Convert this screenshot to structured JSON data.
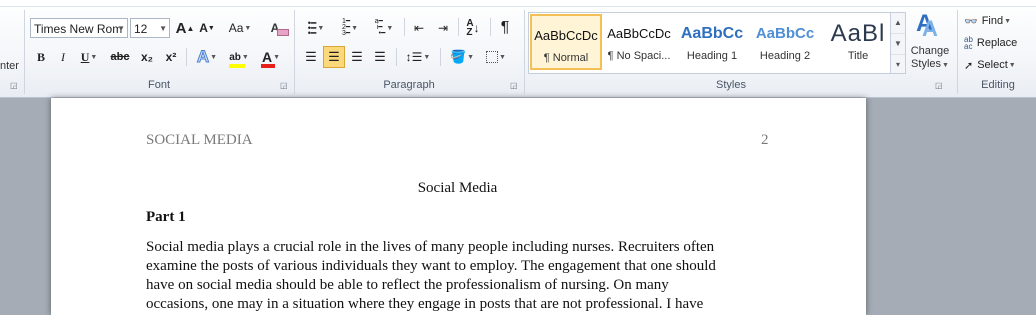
{
  "clipboard": {
    "partial_label": "nter"
  },
  "font": {
    "group_label": "Font",
    "name": "Times New Rom",
    "size": "12",
    "grow_glyph": "A",
    "shrink_glyph": "A",
    "case_glyph": "Aa",
    "clear_glyph": "A",
    "bold": "B",
    "italic": "I",
    "underline": "U",
    "strike": "abc",
    "subscript": "x₂",
    "superscript": "x²",
    "effects_glyph": "A",
    "highlight_glyph": "ab",
    "color_glyph": "A",
    "colors": {
      "highlight": "#ffff00",
      "font_color": "#e8201c",
      "effects": "#4a7fd4"
    }
  },
  "paragraph": {
    "group_label": "Paragraph",
    "pilcrow": "¶"
  },
  "styles": {
    "group_label": "Styles",
    "tiles": [
      {
        "sample": "AaBbCcDc",
        "name": "¶ Normal"
      },
      {
        "sample": "AaBbCcDc",
        "name": "¶ No Spaci..."
      },
      {
        "sample": "AaBbCc",
        "name": "Heading 1"
      },
      {
        "sample": "AaBbCc",
        "name": "Heading 2"
      },
      {
        "sample": "AaBl",
        "name": "Title"
      }
    ],
    "change_styles_line1": "Change",
    "change_styles_line2": "Styles",
    "heading_color": "#2e6fbf"
  },
  "editing": {
    "group_label": "Editing",
    "find": "Find",
    "replace": "Replace",
    "select": "Select"
  },
  "document": {
    "header_left": "SOCIAL MEDIA",
    "page_number": "2",
    "title": "Social Media",
    "part_heading": "Part 1",
    "lines": [
      "Social media plays a crucial role in the lives of many people including nurses. Recruiters often",
      "examine the posts of various individuals they want to employ. The engagement that one should",
      "have on social media should be able to reflect the professionalism  of nursing.  On many",
      "occasions,  one may in a situation where they engage in posts that are not professional.  I have"
    ]
  }
}
